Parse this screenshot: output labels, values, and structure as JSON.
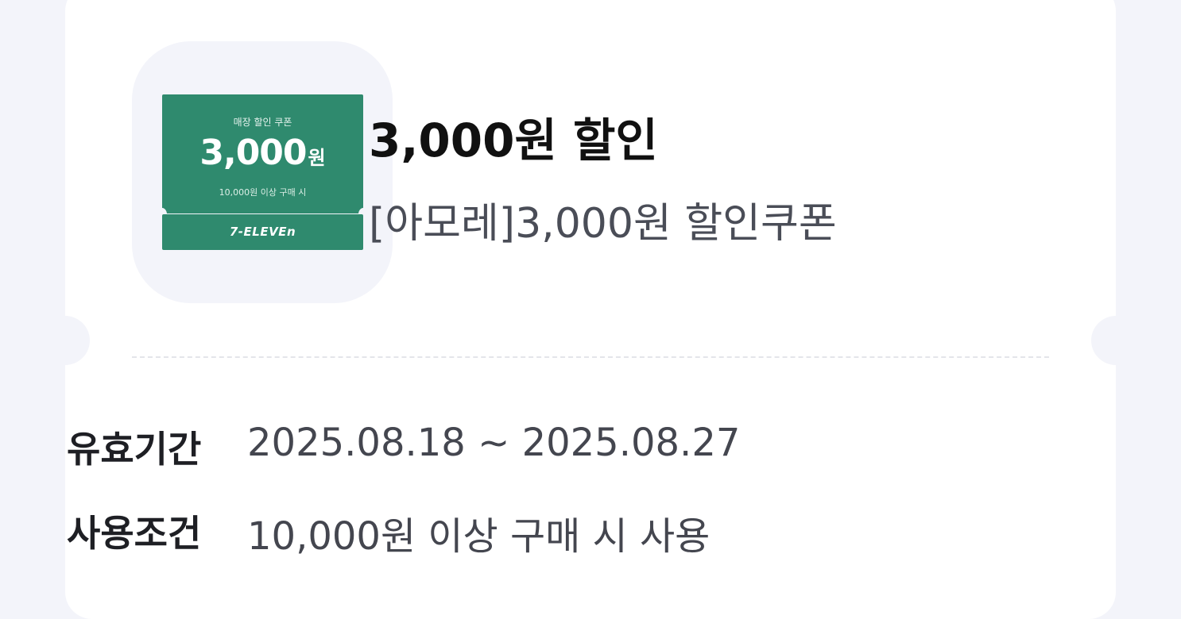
{
  "coupon": {
    "image": {
      "label": "매장 할인 쿠폰",
      "amount": "3,000",
      "unit": "원",
      "condition": "10,000원 이상 구매 시",
      "brand": "7-ELEVEn",
      "color": "#2f8a6e"
    },
    "title": "3,000원 할인",
    "subtitle": "[아모레]3,000원 할인쿠폰"
  },
  "details": {
    "validity_label": "유효기간",
    "validity_value": "2025.08.18 ~ 2025.08.27",
    "condition_label": "사용조건",
    "condition_value": "10,000원 이상 구매 시 사용"
  }
}
